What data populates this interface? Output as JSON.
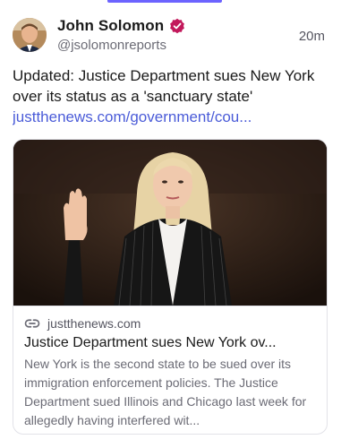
{
  "post": {
    "author": {
      "display_name": "John Solomon",
      "handle": "@jsolomonreports",
      "verified": true,
      "avatar_icon": "author-avatar"
    },
    "timestamp": "20m",
    "text": "Updated: Justice Department sues New York over its status as a 'sanctuary state'",
    "link_text": "justthenews.com/government/cou..."
  },
  "card": {
    "image_icon": "article-photo",
    "link_icon": "link-icon",
    "domain": "justthenews.com",
    "title": "Justice Department sues New York ov...",
    "description": "New York is the second state to be sued over its immigration enforcement policies. The Justice Department sued Illinois and Chicago last week for allegedly having interfered wit..."
  },
  "colors": {
    "accent": "#6c63ff",
    "verified": "#c2185b",
    "link": "#4a5bd8",
    "text_primary": "#1a1a1a",
    "text_secondary": "#6b6b75"
  }
}
